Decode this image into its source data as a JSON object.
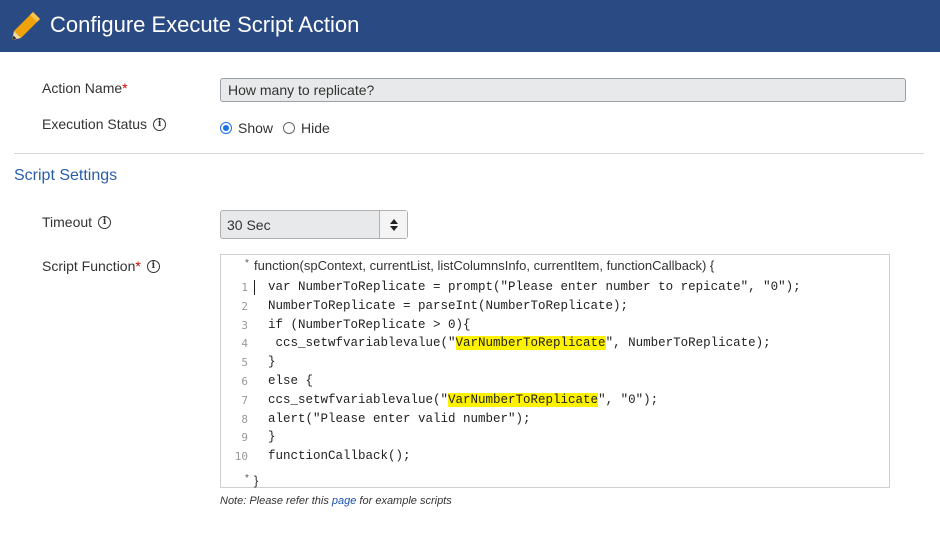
{
  "header": {
    "title": "Configure Execute Script Action",
    "icon": "pencil-icon",
    "background": "#2a4a83",
    "pencil_color": "#f0a20b"
  },
  "fields": {
    "action_name": {
      "label": "Action Name",
      "required_mark": "*",
      "value": "How many to replicate?"
    },
    "execution_status": {
      "label": "Execution Status",
      "info_icon": "info-icon",
      "options": [
        {
          "label": "Show",
          "selected": true
        },
        {
          "label": "Hide",
          "selected": false
        }
      ]
    }
  },
  "script_settings": {
    "section_title": "Script Settings",
    "timeout": {
      "label": "Timeout",
      "value": "30 Sec"
    },
    "script_function": {
      "label": "Script Function",
      "required_mark": "*",
      "signature": "function(spContext, currentList, listColumnsInfo, currentItem, functionCallback) {",
      "fold_marker": "*",
      "closing": "}",
      "lines": [
        {
          "n": "1",
          "indent": 0,
          "parts": [
            {
              "t": "var NumberToReplicate = prompt(\"Please enter number to repicate\", \"0\");"
            }
          ]
        },
        {
          "n": "2",
          "indent": 0,
          "parts": [
            {
              "t": "NumberToReplicate = parseInt(NumberToReplicate);"
            }
          ]
        },
        {
          "n": "3",
          "indent": 0,
          "parts": [
            {
              "t": "if (NumberToReplicate > 0){"
            }
          ]
        },
        {
          "n": "4",
          "indent": 1,
          "parts": [
            {
              "t": "ccs_setwfvariablevalue(\""
            },
            {
              "t": "VarNumberToReplicate",
              "hl": true
            },
            {
              "t": "\", NumberToReplicate);"
            }
          ]
        },
        {
          "n": "5",
          "indent": 0,
          "parts": [
            {
              "t": "}"
            }
          ]
        },
        {
          "n": "6",
          "indent": 0,
          "parts": [
            {
              "t": "else {"
            }
          ]
        },
        {
          "n": "7",
          "indent": 0,
          "parts": [
            {
              "t": "ccs_setwfvariablevalue(\""
            },
            {
              "t": "VarNumberToReplicate",
              "hl": true
            },
            {
              "t": "\", \"0\");"
            }
          ]
        },
        {
          "n": "8",
          "indent": 0,
          "parts": [
            {
              "t": "alert(\"Please enter valid number\");"
            }
          ]
        },
        {
          "n": "9",
          "indent": 0,
          "parts": [
            {
              "t": "}"
            }
          ]
        },
        {
          "n": "10",
          "indent": 0,
          "parts": [
            {
              "t": "functionCallback();"
            }
          ]
        }
      ]
    },
    "note": {
      "prefix": "Note: Please refer this ",
      "link": "page",
      "suffix": " for example scripts"
    }
  }
}
